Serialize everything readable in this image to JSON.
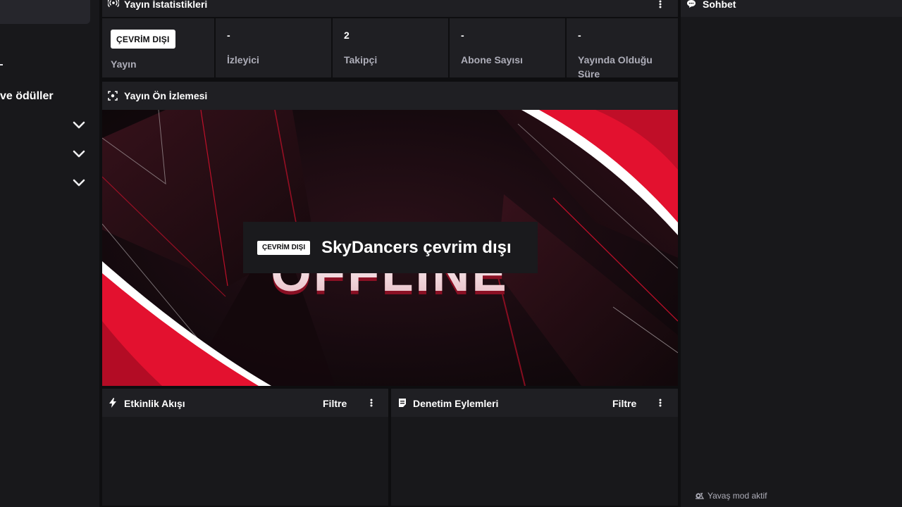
{
  "sidebar": {
    "rewards_label": "ve ödüller"
  },
  "stats": {
    "title": "Yayın İstatistikleri",
    "items": [
      {
        "badge": "ÇEVRİM DIŞI",
        "label": "Yayın"
      },
      {
        "value": "-",
        "label": "İzleyici"
      },
      {
        "value": "2",
        "label": "Takipçi"
      },
      {
        "value": "-",
        "label": "Abone Sayısı"
      },
      {
        "value": "-",
        "label": "Yayında Olduğu Süre"
      }
    ]
  },
  "preview": {
    "title": "Yayın Ön İzlemesi",
    "badge": "ÇEVRİM DIŞI",
    "status_text": "SkyDancers çevrim dışı",
    "banner_text": "OFFLINE"
  },
  "activity_feed": {
    "title": "Etkinlik Akışı",
    "filter_label": "Filtre"
  },
  "mod_actions": {
    "title": "Denetim Eylemleri",
    "filter_label": "Filtre"
  },
  "chat": {
    "title": "Sohbet",
    "slow_mode": "Yavaş mod aktif"
  },
  "colors": {
    "background": "#0e0e10",
    "panel": "#18181b",
    "header": "#1f1f23",
    "muted_text": "#adadb8",
    "banner_red": "#e3112f"
  },
  "icons": {
    "stats": "broadcast-icon",
    "preview": "preview-icon",
    "activity": "lightning-icon",
    "mod": "document-icon",
    "chat": "chat-bubble-icon",
    "slow_mode": "snail-icon",
    "menu": "kebab-icon",
    "expand": "chevron-down-icon"
  }
}
